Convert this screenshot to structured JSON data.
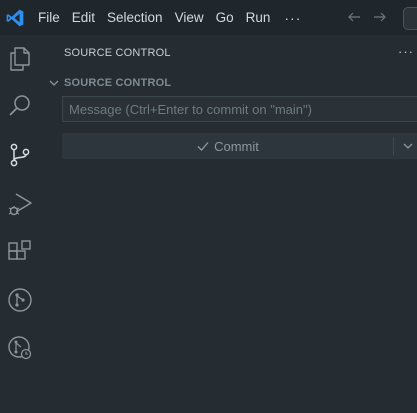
{
  "titlebar": {
    "menu": [
      "File",
      "Edit",
      "Selection",
      "View",
      "Go",
      "Run"
    ],
    "more": "···",
    "logo_color": "#2d8ff0"
  },
  "activity_bar": {
    "icons": [
      "explorer-icon",
      "search-icon",
      "source-control-icon",
      "run-debug-icon",
      "extensions-icon",
      "git-graph-icon",
      "git-history-icon"
    ]
  },
  "sidebar": {
    "title": "SOURCE CONTROL",
    "more": "···",
    "section_title": "SOURCE CONTROL",
    "commit_placeholder": "Message (Ctrl+Enter to commit on \"main\")",
    "commit_label": "Commit"
  }
}
